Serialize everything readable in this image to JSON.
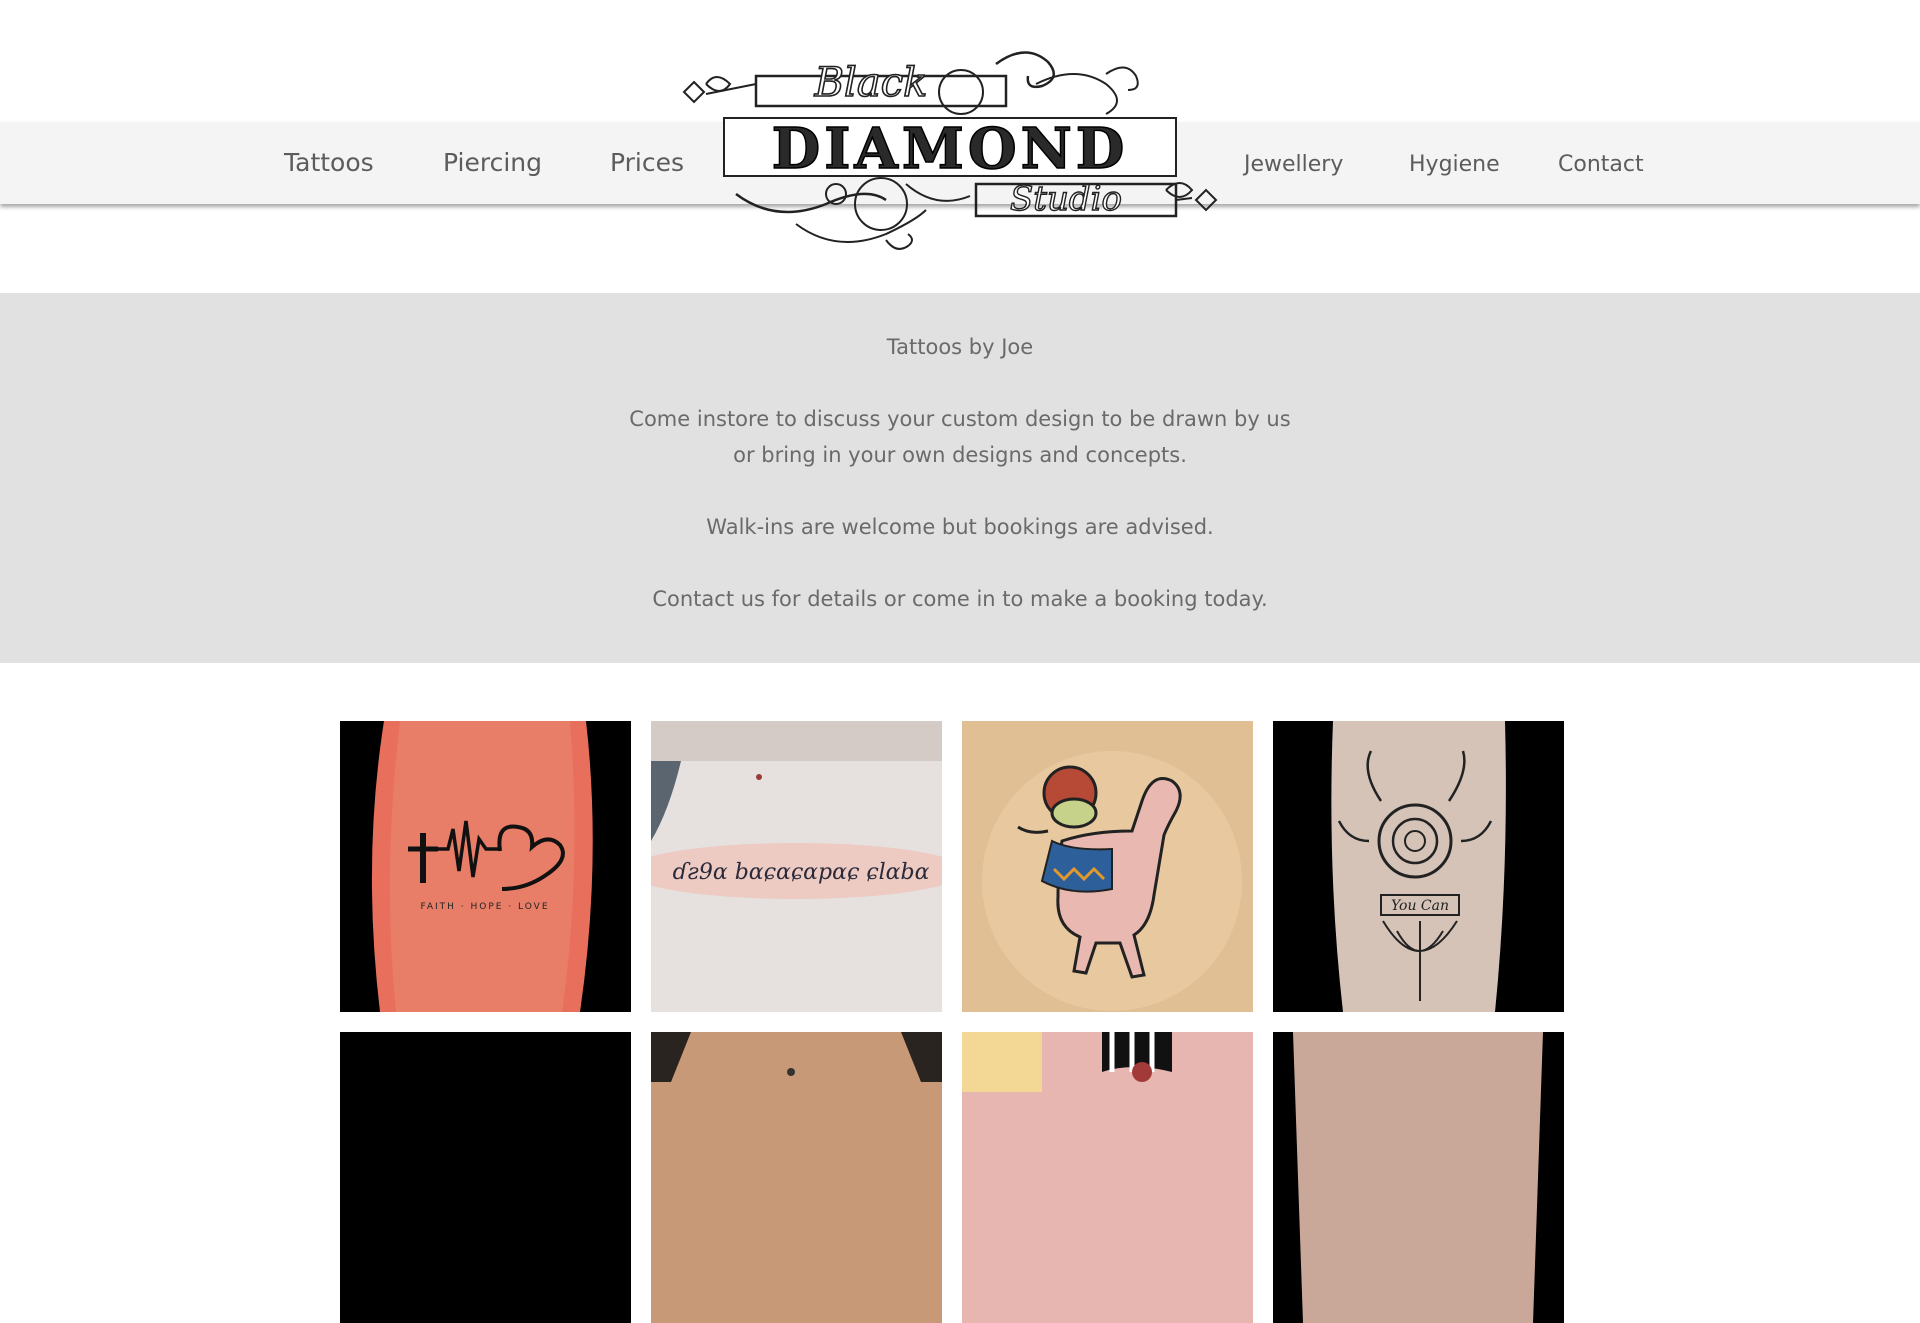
{
  "nav": {
    "left": [
      "Tattoos",
      "Piercing",
      "Prices"
    ],
    "right": [
      "Jewellery",
      "Hygiene",
      "Contact"
    ]
  },
  "logo": {
    "top_word": "Black",
    "main_word": "DIAMOND",
    "bottom_word": "Studio"
  },
  "intro": {
    "title": "Tattoos by Joe",
    "lines": [
      "Come instore to discuss your custom design to be drawn by us",
      "or bring in your own designs and concepts.",
      "Walk-ins are welcome but bookings are advised.",
      "Contact us for details or come in to make a booking today."
    ]
  },
  "gallery": {
    "tile1_caption": "FAITH · HOPE · LOVE",
    "tile2_script": "ɗƨ9ɑ bɑɕɑɕɑpɑɕ ɕlɑbɑ",
    "tile4_banner": "You Can"
  },
  "colors": {
    "nav_bg": "#f4f4f4",
    "intro_bg": "#e1e1e1",
    "text": "#666666"
  },
  "icons": [
    "logo-flourish-icon"
  ]
}
